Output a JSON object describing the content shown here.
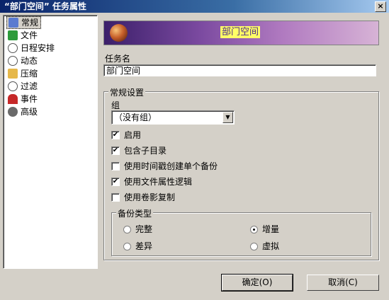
{
  "window": {
    "title": "“部门空间” 任务属性",
    "close_label": "×"
  },
  "sidebar": {
    "items": [
      {
        "label": "常规",
        "icon": "general-icon",
        "color": "#5b7bd0"
      },
      {
        "label": "文件",
        "icon": "files-icon",
        "color": "#2e9b3b"
      },
      {
        "label": "日程安排",
        "icon": "clock-icon",
        "color": "#9a9a9a"
      },
      {
        "label": "动态",
        "icon": "dynamic-icon",
        "color": "#7a7a7a"
      },
      {
        "label": "压缩",
        "icon": "folder-icon",
        "color": "#e6b84a"
      },
      {
        "label": "过滤",
        "icon": "filter-icon",
        "color": "#8a8a8a"
      },
      {
        "label": "事件",
        "icon": "magnet-icon",
        "color": "#c62828"
      },
      {
        "label": "高级",
        "icon": "gear-icon",
        "color": "#6a6a6a"
      }
    ]
  },
  "banner": {
    "text": "部门空间"
  },
  "task_name": {
    "label": "任务名",
    "value": "部门空间"
  },
  "general": {
    "group_title": "常规设置",
    "group_label": "组",
    "group_value": "（没有组）",
    "checkboxes": [
      {
        "label": "启用",
        "checked": true
      },
      {
        "label": "包含子目录",
        "checked": true
      },
      {
        "label": "使用时间戳创建单个备份",
        "checked": false
      },
      {
        "label": "使用文件属性逻辑",
        "checked": true
      },
      {
        "label": "使用卷影复制",
        "checked": false
      }
    ],
    "backup_type": {
      "title": "备份类型",
      "options": [
        {
          "label": "完整",
          "selected": false
        },
        {
          "label": "增量",
          "selected": true
        },
        {
          "label": "差异",
          "selected": false
        },
        {
          "label": "虚拟",
          "selected": false
        }
      ]
    }
  },
  "buttons": {
    "ok": "确定(O)",
    "cancel": "取消(C)"
  }
}
